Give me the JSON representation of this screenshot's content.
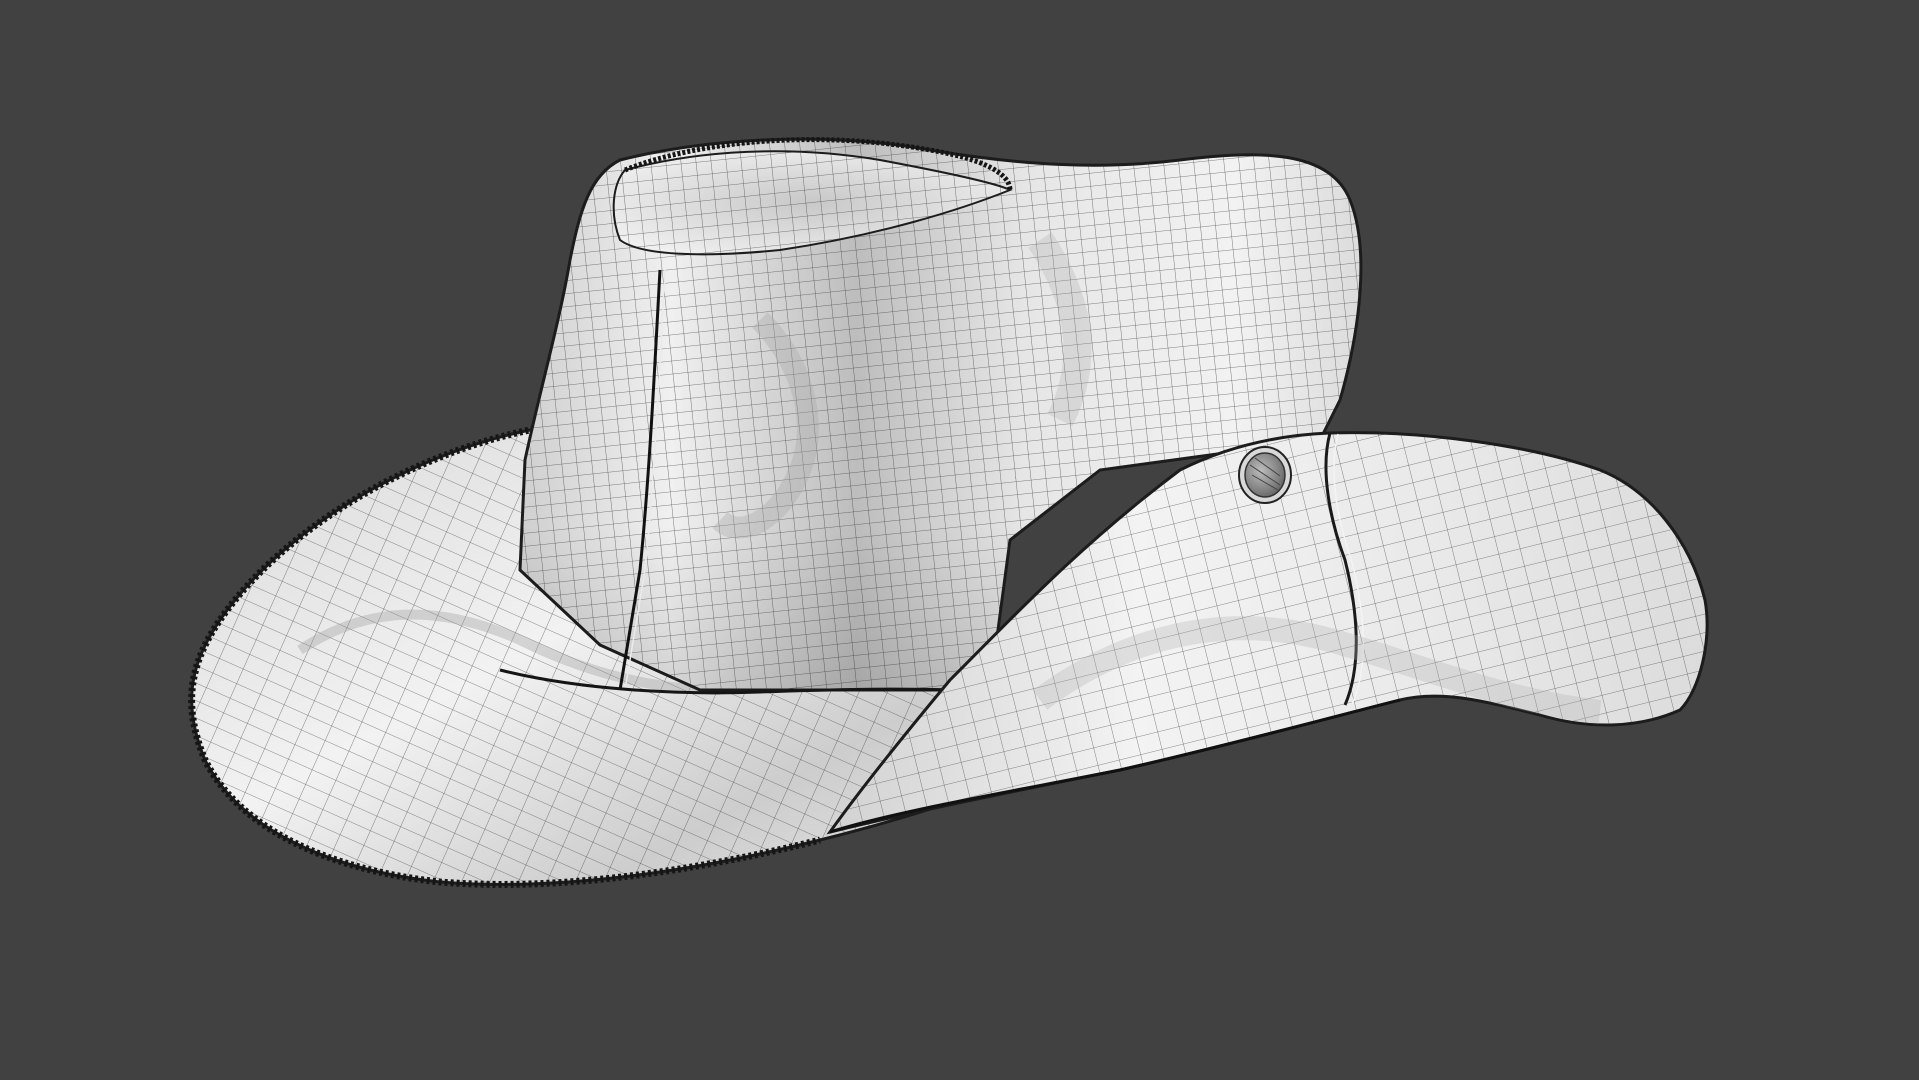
{
  "viewport": {
    "background": "#414141",
    "render_style": "clay wireframe overlay"
  },
  "model": {
    "subject": "hat-model",
    "surface_color": "#e9e9e9",
    "shadow_color": "#9a9a9a",
    "wire_color": "#2a2a2a",
    "button_color": "#8c8c8c"
  }
}
